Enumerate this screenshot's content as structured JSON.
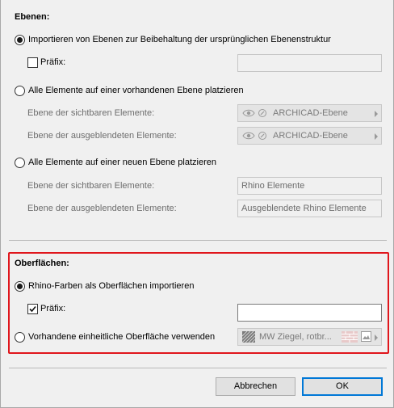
{
  "layers": {
    "title": "Ebenen:",
    "option_import": "Importieren von Ebenen zur Beibehaltung der ursprünglichen Ebenenstruktur",
    "prefix_label": "Präfix:",
    "prefix_value": "",
    "option_existing": "Alle Elemente auf einer vorhandenen Ebene platzieren",
    "visible_label": "Ebene der sichtbaren Elemente:",
    "visible_value": "ARCHICAD-Ebene",
    "hidden_label": "Ebene der ausgeblendeten Elemente:",
    "hidden_value": "ARCHICAD-Ebene",
    "option_new": "Alle Elemente auf einer neuen Ebene platzieren",
    "new_visible_label": "Ebene der sichtbaren Elemente:",
    "new_visible_value": "Rhino Elemente",
    "new_hidden_label": "Ebene der ausgeblendeten Elemente:",
    "new_hidden_value": "Ausgeblendete Rhino Elemente",
    "selected_option": "import"
  },
  "surfaces": {
    "title": "Oberflächen:",
    "option_rhino_colors": "Rhino-Farben als Oberflächen importieren",
    "prefix_label": "Präfix:",
    "prefix_checked": true,
    "prefix_value": "",
    "option_uniform": "Vorhandene einheitliche Oberfläche verwenden",
    "uniform_value": "MW Ziegel, rotbr...",
    "selected_option": "rhino_colors"
  },
  "buttons": {
    "cancel": "Abbrechen",
    "ok": "OK"
  },
  "colors": {
    "highlight_border": "#e0161c",
    "default_button_border": "#0078d7"
  }
}
